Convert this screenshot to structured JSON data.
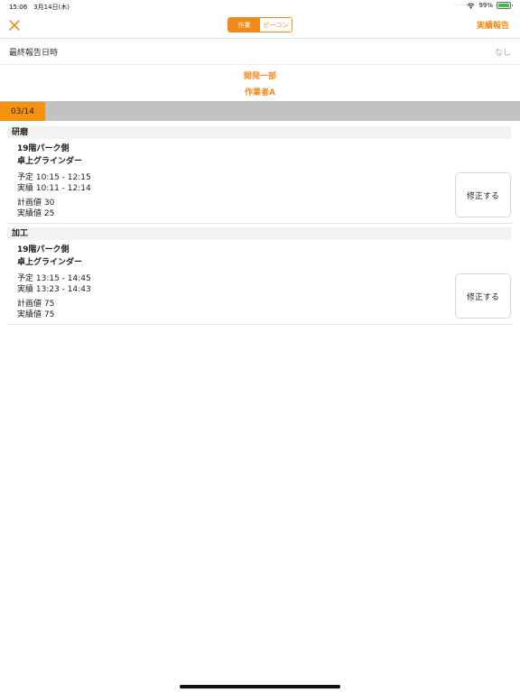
{
  "status_bar": {
    "time": "15:06",
    "date": "3月14日(木)",
    "battery": "99%"
  },
  "navbar": {
    "segments": [
      {
        "label": "作業",
        "active": true
      },
      {
        "label": "ビーコン",
        "active": false
      }
    ],
    "report_button": "実績報告"
  },
  "last_report": {
    "label": "最終報告日時",
    "value": "なし"
  },
  "department": "開発一部",
  "worker": "作業者A",
  "date_tab": "03/14",
  "tasks": [
    {
      "category": "研磨",
      "location": "19階パーク側",
      "tool": "卓上グラインダー",
      "planned": "予定 10:15 - 12:15",
      "actual": "実績 10:11 - 12:14",
      "plan_value": "計画値 30",
      "actual_value": "実績値 25",
      "edit_label": "修正する"
    },
    {
      "category": "加工",
      "location": "19階パーク側",
      "tool": "卓上グラインダー",
      "planned": "予定 13:15 - 14:45",
      "actual": "実績 13:23 - 14:43",
      "plan_value": "計画値 75",
      "actual_value": "実績値 75",
      "edit_label": "修正する"
    }
  ],
  "colors": {
    "accent": "#f28a1a",
    "date_tab": "#f7920f",
    "date_bar": "#c2c2c2"
  }
}
